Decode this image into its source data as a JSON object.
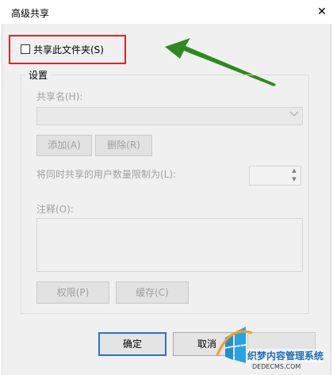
{
  "window": {
    "title": "高级共享",
    "close_glyph": "✕"
  },
  "share_checkbox": {
    "label": "共享此文件夹(S)",
    "checked": false
  },
  "highlight_color": "#e0242b",
  "arrow_color": "#2e8a1e",
  "settings": {
    "group_title": "设置",
    "share_name_label": "共享名(H):",
    "share_name_value": "",
    "add_label": "添加(A)",
    "remove_label": "删除(R)",
    "limit_label": "将同时共享的用户数量限制为(L):",
    "limit_value": "",
    "note_label": "注释(O):",
    "note_value": "",
    "permissions_label": "权限(P)",
    "caching_label": "缓存(C)"
  },
  "buttons": {
    "ok": "确定",
    "cancel": "取消"
  },
  "watermark": {
    "line1": "织梦内容管理系统",
    "line2": "DEDECMS.COM"
  }
}
